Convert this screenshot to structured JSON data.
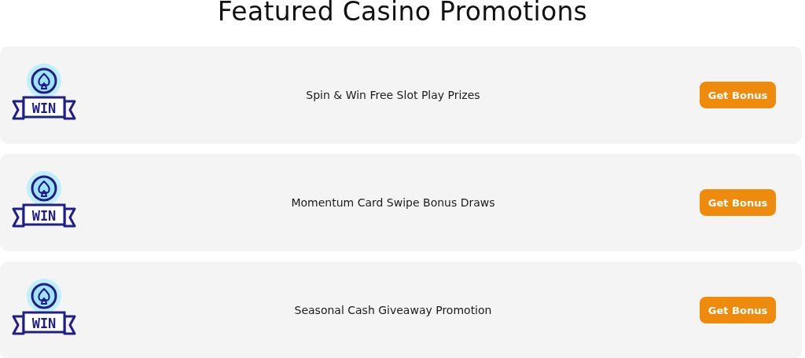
{
  "title": "Featured Casino Promotions",
  "promotions": [
    {
      "icon_label": "WIN",
      "name": "Spin & Win Free Slot Play Prizes",
      "button": "Get Bonus"
    },
    {
      "icon_label": "WIN",
      "name": "Momentum Card Swipe Bonus Draws",
      "button": "Get Bonus"
    },
    {
      "icon_label": "WIN",
      "name": "Seasonal Cash Giveaway Promotion",
      "button": "Get Bonus"
    }
  ]
}
